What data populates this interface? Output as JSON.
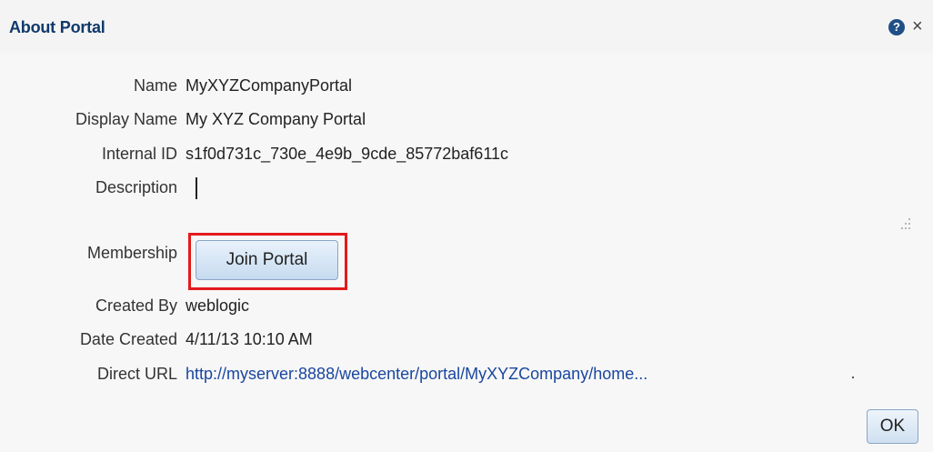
{
  "dialog": {
    "title": "About Portal",
    "help_icon": "?",
    "close_icon": "×"
  },
  "fields": {
    "name": {
      "label": "Name",
      "value": "MyXYZCompanyPortal"
    },
    "display_name": {
      "label": "Display Name",
      "value": "My XYZ Company Portal"
    },
    "internal_id": {
      "label": "Internal ID",
      "value": "s1f0d731c_730e_4e9b_9cde_85772baf611c"
    },
    "description": {
      "label": "Description",
      "value": ""
    },
    "membership": {
      "label": "Membership",
      "button_label": "Join Portal"
    },
    "created_by": {
      "label": "Created By",
      "value": "weblogic"
    },
    "date_created": {
      "label": "Date Created",
      "value": "4/11/13 10:10 AM"
    },
    "direct_url": {
      "label": "Direct URL",
      "value": "http://myserver:8888/webcenter/portal/MyXYZCompany/home..."
    }
  },
  "footer": {
    "ok_label": "OK"
  },
  "colors": {
    "title": "#10396b",
    "link": "#1a47a0",
    "highlight": "#e31a1c"
  }
}
